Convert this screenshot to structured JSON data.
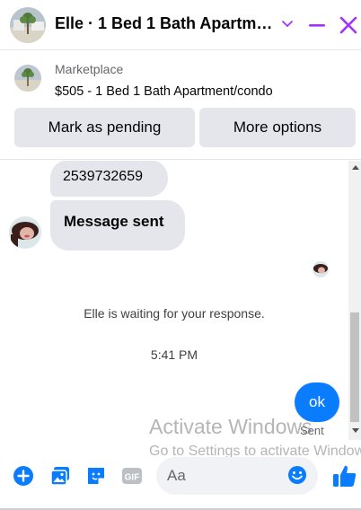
{
  "header": {
    "title": "Elle · 1 Bed 1 Bath Apartme...",
    "icons": [
      "listing-photo",
      "chevron-down-icon",
      "minimize-icon",
      "close-icon"
    ],
    "accent": "#a033ff"
  },
  "marketplace": {
    "label": "Marketplace",
    "item": "$505 - 1 Bed 1 Bath Apartment/condo",
    "buttons": {
      "pending": "Mark as pending",
      "more": "More options"
    }
  },
  "messages": {
    "incoming": [
      {
        "text": "2539732659"
      },
      {
        "text": "Message sent"
      }
    ],
    "status_line": "Elle is waiting for your response.",
    "timestamp": "5:41 PM",
    "outgoing": {
      "text": "ok",
      "status": "Sent"
    }
  },
  "watermark": {
    "line1": "Activate Windows",
    "line2": "Go to Settings to activate Windows."
  },
  "composer": {
    "placeholder": "Aa",
    "icons": [
      "plus-icon",
      "gallery-icon",
      "sticker-icon",
      "gif-icon",
      "emoji-icon",
      "like-icon"
    ],
    "accent": "#0a7cff"
  }
}
